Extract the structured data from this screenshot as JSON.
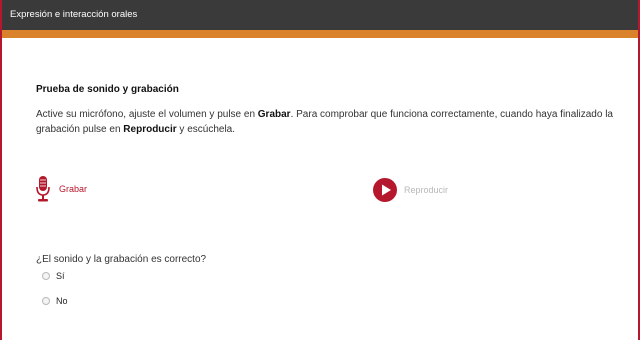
{
  "window": {
    "title": "Expresión e interacción orales"
  },
  "colors": {
    "titlebar": "#3a3a3a",
    "accent_bar": "#d9822b",
    "brand_red": "#b5182d",
    "disabled_text": "#b8b8b8"
  },
  "section": {
    "title": "Prueba de sonido y grabación",
    "instructions": {
      "part1": "Active su micrófono, ajuste el volumen y pulse en ",
      "record_word": "Grabar",
      "part2": ". Para comprobar que funciona correctamente, cuando haya finalizado la grabación pulse en ",
      "play_word": "Reproducir",
      "part3": " y escúchela."
    }
  },
  "controls": {
    "record": {
      "label": "Grabar",
      "icon": "microphone-icon"
    },
    "play": {
      "label": "Reproducir",
      "icon": "play-icon",
      "enabled": false
    }
  },
  "question": {
    "text": "¿El sonido y la grabación es correcto?",
    "options": [
      {
        "label": "Sí",
        "selected": false
      },
      {
        "label": "No",
        "selected": false
      }
    ]
  }
}
